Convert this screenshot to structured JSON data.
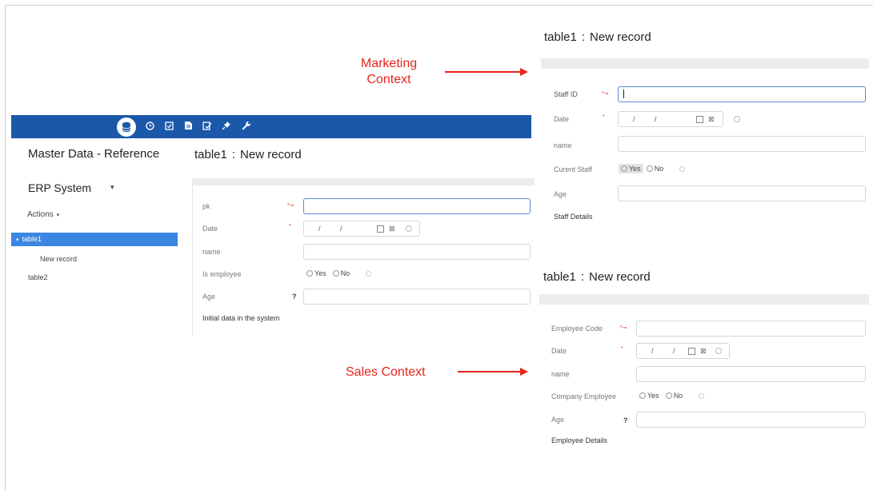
{
  "app": {
    "toolbar_icons": [
      "database-icon",
      "clock-icon",
      "checkbox-icon",
      "document-icon",
      "edit-check-icon",
      "pin-icon",
      "wrench-icon"
    ],
    "title": "Master Data - Reference",
    "system_name": "ERP System",
    "actions_label": "Actions",
    "nav": {
      "selected": "table1",
      "sub_item": "New record",
      "item2": "table2"
    },
    "colors": {
      "toolbar": "#1b58a9",
      "nav_selected": "#3a86e0",
      "annotation": "#e8231a"
    }
  },
  "main_form": {
    "table": "table1",
    "sep": ":",
    "record": "New record",
    "fields": {
      "pk_label": "pk",
      "date_label": "Date",
      "date_value": "/  /",
      "name_label": "name",
      "employee_label": "Is employee",
      "yes": "Yes",
      "no": "No",
      "age_label": "Age",
      "age_hint": "?"
    },
    "section": "Initial data in the system"
  },
  "marketing": {
    "annotation_line1": "Marketing",
    "annotation_line2": "Context",
    "table": "table1",
    "sep": ":",
    "record": "New record",
    "fields": {
      "id_label": "Staff ID",
      "date_label": "Date",
      "date_value": "/  /",
      "name_label": "name",
      "employee_label": "Curent Staff",
      "yes": "Yes",
      "no": "No",
      "age_label": "Age"
    },
    "section": "Staff Details"
  },
  "sales": {
    "annotation": "Sales Context",
    "table": "table1",
    "sep": ":",
    "record": "New record",
    "fields": {
      "id_label": "Employee Code",
      "date_label": "Date",
      "date_value": "/  /",
      "name_label": "name",
      "employee_label": "Company Employee",
      "yes": "Yes",
      "no": "No",
      "age_label": "Age",
      "age_hint": "?"
    },
    "section": "Employee Details"
  }
}
